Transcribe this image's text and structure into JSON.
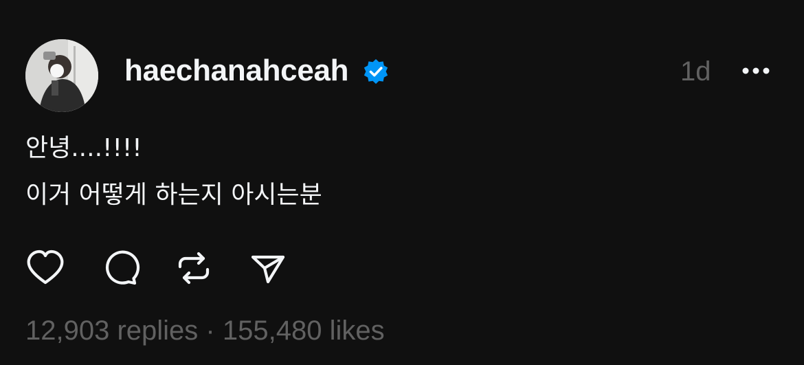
{
  "post": {
    "username": "haechanahceah",
    "verified": true,
    "timestamp": "1d",
    "text_lines": [
      "안녕....!!!!",
      "이거 어떻게 하는지 아시는분"
    ],
    "stats": {
      "replies": "12,903 replies",
      "separator": "·",
      "likes": "155,480 likes"
    }
  },
  "colors": {
    "background": "#101010",
    "primary_text": "#f3f5f7",
    "secondary_text": "#616161",
    "verified_badge": "#0095f6"
  },
  "icons": [
    "more-icon",
    "heart-icon",
    "comment-icon",
    "repost-icon",
    "share-icon",
    "verified-icon"
  ]
}
